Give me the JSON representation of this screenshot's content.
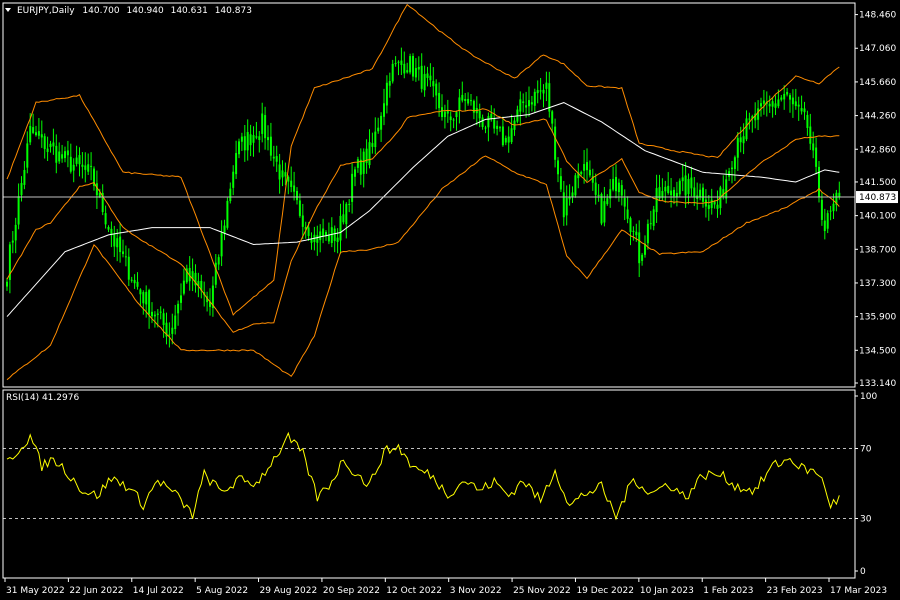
{
  "header": {
    "symbol": "EURJPY,Daily",
    "open": "140.700",
    "high": "140.940",
    "low": "140.631",
    "close": "140.873"
  },
  "rsi_label": "RSI(14) 41.2976",
  "current_price_label": "140.873",
  "colors": {
    "background": "#000000",
    "bull_bar": "#00ff00",
    "bear_bar": "#00ff00",
    "bollinger": "#ff8c00",
    "moving_average": "#ffffff",
    "rsi_line": "#ffff00",
    "frame": "#ffffff"
  },
  "chart_data": [
    {
      "type": "candlestick",
      "title": "EURJPY,Daily",
      "ylim": [
        133.14,
        148.9
      ],
      "y_ticks": [
        "148.460",
        "147.060",
        "145.660",
        "144.260",
        "142.860",
        "141.500",
        "140.100",
        "138.700",
        "137.300",
        "135.900",
        "134.500",
        "133.140"
      ],
      "x_ticks": [
        "31 May 2022",
        "22 Jun 2022",
        "14 Jul 2022",
        "5 Aug 2022",
        "29 Aug 2022",
        "20 Sep 2022",
        "12 Oct 2022",
        "3 Nov 2022",
        "25 Nov 2022",
        "19 Dec 2022",
        "10 Jan 2023",
        "1 Feb 2023",
        "23 Feb 2023",
        "17 Mar 2023"
      ],
      "last_close": 140.873,
      "anchors": {
        "t": [
          0,
          8,
          20,
          29,
          37,
          46,
          56,
          62,
          70,
          79,
          88,
          95,
          106,
          114,
          120,
          126,
          132,
          138,
          145,
          152,
          158,
          165,
          172,
          178,
          186,
          192,
          198,
          205,
          211,
          218,
          224,
          230,
          238,
          245,
          252,
          262,
          268,
          276,
          282,
          287
        ],
        "close": [
          137.8,
          143.6,
          142.4,
          141.8,
          139.0,
          136.9,
          135.2,
          137.8,
          136.3,
          142.8,
          143.9,
          141.6,
          139.2,
          139.3,
          141.9,
          142.9,
          146.1,
          146.5,
          145.5,
          144.0,
          145.0,
          143.9,
          143.2,
          144.8,
          145.4,
          140.3,
          142.3,
          140.2,
          141.8,
          138.4,
          140.8,
          141.3,
          141.2,
          140.4,
          143.4,
          144.6,
          145.1,
          143.8,
          139.6,
          140.9
        ]
      },
      "bollinger_upper_anchors": [
        [
          0,
          141.6
        ],
        [
          10,
          144.8
        ],
        [
          25,
          145.1
        ],
        [
          40,
          141.9
        ],
        [
          60,
          141.7
        ],
        [
          78,
          136.0
        ],
        [
          92,
          137.4
        ],
        [
          98,
          143.0
        ],
        [
          106,
          145.4
        ],
        [
          116,
          145.8
        ],
        [
          126,
          146.2
        ],
        [
          138,
          148.9
        ],
        [
          150,
          147.7
        ],
        [
          160,
          146.8
        ],
        [
          175,
          145.8
        ],
        [
          185,
          146.8
        ],
        [
          192,
          146.4
        ],
        [
          200,
          145.5
        ],
        [
          212,
          145.4
        ],
        [
          218,
          143.1
        ],
        [
          230,
          142.8
        ],
        [
          245,
          142.5
        ],
        [
          262,
          144.8
        ],
        [
          272,
          145.9
        ],
        [
          280,
          145.6
        ],
        [
          287,
          146.3
        ]
      ],
      "bollinger_lower_anchors": [
        [
          0,
          133.3
        ],
        [
          15,
          134.7
        ],
        [
          30,
          138.9
        ],
        [
          45,
          136.5
        ],
        [
          60,
          134.5
        ],
        [
          72,
          134.5
        ],
        [
          85,
          134.5
        ],
        [
          98,
          133.4
        ],
        [
          106,
          135.1
        ],
        [
          115,
          138.6
        ],
        [
          126,
          138.7
        ],
        [
          135,
          139.0
        ],
        [
          150,
          141.2
        ],
        [
          165,
          142.6
        ],
        [
          175,
          141.9
        ],
        [
          186,
          141.4
        ],
        [
          193,
          138.4
        ],
        [
          200,
          137.5
        ],
        [
          212,
          139.5
        ],
        [
          225,
          138.5
        ],
        [
          240,
          138.6
        ],
        [
          255,
          139.8
        ],
        [
          268,
          140.4
        ],
        [
          280,
          141.2
        ],
        [
          287,
          140.5
        ]
      ],
      "moving_average_anchors": [
        [
          0,
          135.9
        ],
        [
          20,
          138.6
        ],
        [
          35,
          139.3
        ],
        [
          50,
          139.6
        ],
        [
          70,
          139.6
        ],
        [
          85,
          138.9
        ],
        [
          100,
          139.0
        ],
        [
          115,
          139.4
        ],
        [
          125,
          140.3
        ],
        [
          140,
          142.1
        ],
        [
          152,
          143.4
        ],
        [
          165,
          144.1
        ],
        [
          180,
          144.3
        ],
        [
          192,
          144.8
        ],
        [
          205,
          144.0
        ],
        [
          220,
          142.8
        ],
        [
          240,
          141.9
        ],
        [
          260,
          141.7
        ],
        [
          272,
          141.5
        ],
        [
          282,
          142.0
        ],
        [
          287,
          141.9
        ]
      ]
    },
    {
      "type": "line",
      "title": "RSI(14) 41.2976",
      "ylim": [
        0,
        100
      ],
      "y_ticks": [
        "100",
        "70",
        "30",
        "0"
      ],
      "levels": [
        70,
        30
      ],
      "latest_value": 41.2976,
      "anchors": {
        "t": [
          0,
          8,
          12,
          16,
          20,
          26,
          31,
          36,
          42,
          47,
          52,
          58,
          64,
          68,
          74,
          80,
          86,
          92,
          97,
          102,
          107,
          112,
          116,
          120,
          125,
          130,
          135,
          140,
          146,
          152,
          158,
          163,
          168,
          173,
          178,
          184,
          189,
          194,
          199,
          205,
          210,
          216,
          222,
          228,
          234,
          240,
          246,
          252,
          258,
          264,
          270,
          275,
          280,
          284,
          287
        ],
        "value": [
          62,
          77,
          60,
          64,
          58,
          46,
          43,
          53,
          48,
          38,
          52,
          44,
          32,
          55,
          45,
          52,
          50,
          64,
          76,
          67,
          42,
          51,
          64,
          56,
          49,
          68,
          71,
          59,
          55,
          44,
          52,
          46,
          51,
          43,
          52,
          40,
          58,
          37,
          44,
          48,
          31,
          53,
          44,
          50,
          42,
          55,
          55,
          48,
          46,
          60,
          64,
          58,
          56,
          38,
          41
        ]
      }
    }
  ]
}
